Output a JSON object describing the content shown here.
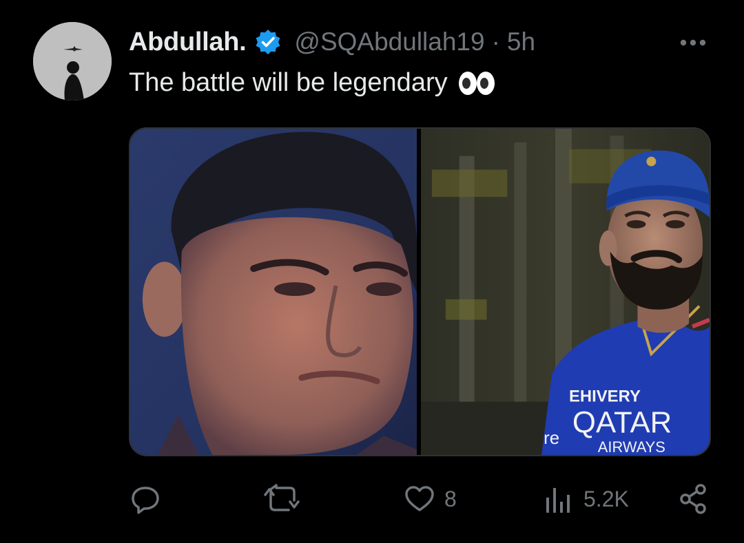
{
  "author": {
    "display_name": "Abdullah.",
    "handle": "@SQAbdullah19",
    "separator": "·",
    "time": "5h",
    "verified_color": "#1d9bf0"
  },
  "tweet": {
    "text": "The battle will be legendary"
  },
  "metrics": {
    "likes": "8",
    "views": "5.2K"
  },
  "icons": {
    "more": "more-horizontal-icon",
    "reply": "reply-icon",
    "retweet": "retweet-icon",
    "like": "heart-icon",
    "views": "views-chart-icon",
    "share": "share-icon",
    "emoji": "eyes-emoji"
  },
  "media": {
    "left_image": "Man in dark shirt with close-cropped hair looking sideways",
    "right_image": "Bearded man in blue cap and blue sports jersey",
    "jersey_text_top": "EHIVERY",
    "jersey_text_brand": "QATAR",
    "jersey_text_bottom": "AIRWAYS",
    "jersey_text_side": "re"
  },
  "colors": {
    "background": "#000000",
    "text_primary": "#e7e9ea",
    "text_secondary": "#71767b",
    "accent": "#1d9bf0"
  }
}
